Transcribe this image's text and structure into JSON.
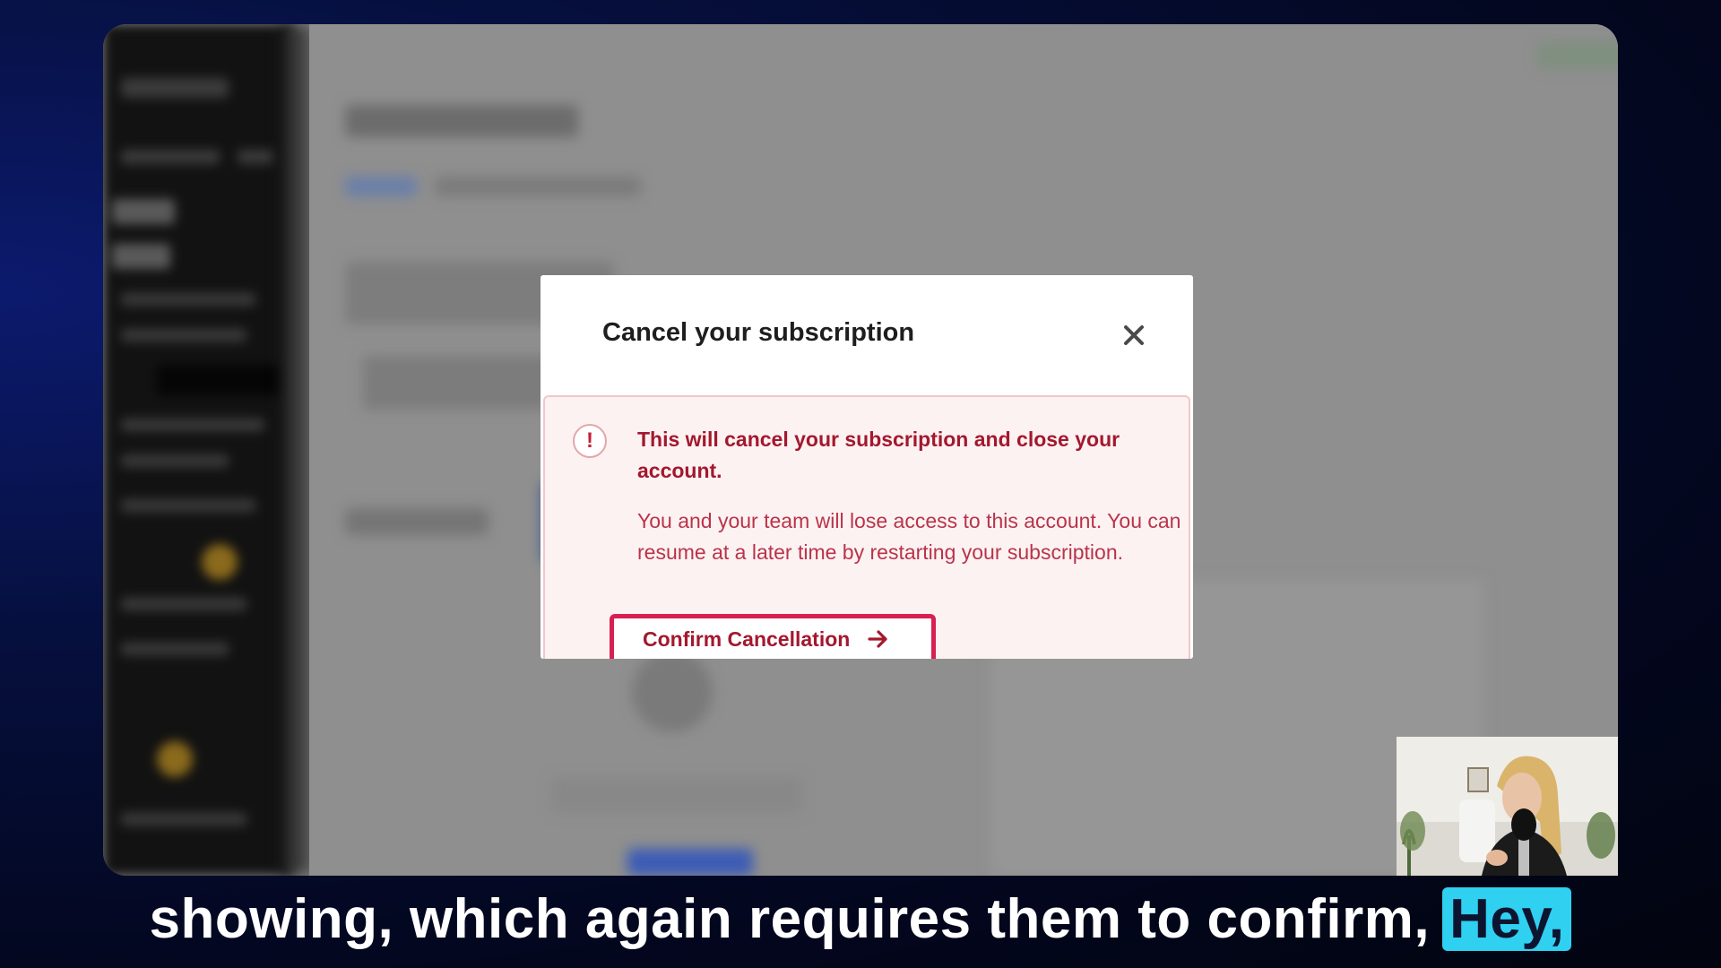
{
  "modal": {
    "title": "Cancel your subscription",
    "close_icon": "close-icon",
    "alert": {
      "icon": "exclamation-icon",
      "heading": "This will cancel your subscription and close your account.",
      "body": "You and your team will lose access to this account. You can resume at a later time by restarting your subscription."
    },
    "confirm_label": "Confirm Cancellation",
    "confirm_icon": "arrow-right-icon"
  },
  "caption": {
    "text": "showing, which again requires them to confirm,",
    "highlight": "Hey,"
  },
  "colors": {
    "alert_text": "#a3182e",
    "alert_background": "#fdf2f2",
    "confirm_highlight_border": "#d81f52",
    "caption_highlight": "#2fd0f0"
  }
}
